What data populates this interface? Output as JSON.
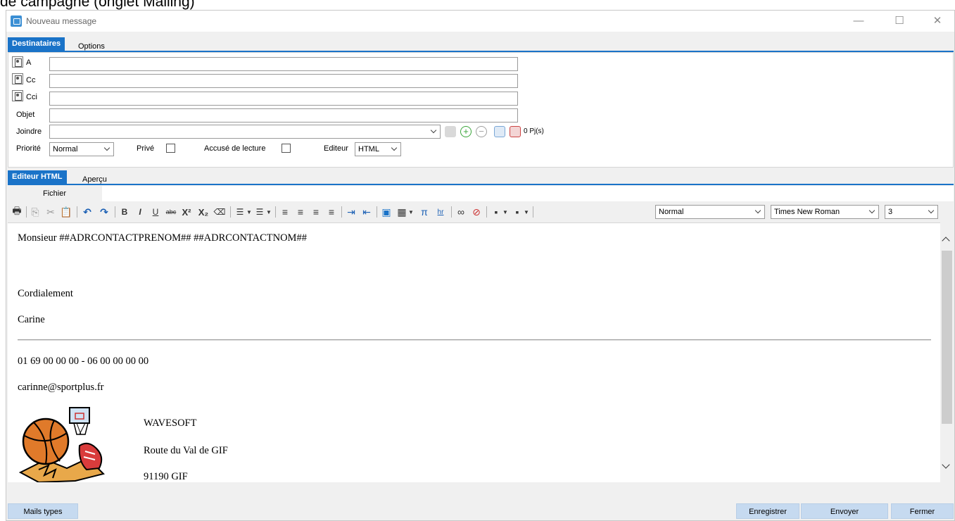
{
  "caption": "de campagne (onglet Mailing)",
  "window": {
    "title": "Nouveau message",
    "minimize": "—",
    "maximize": "☐",
    "close": "✕"
  },
  "top_tabs": [
    {
      "label": "Destinataires",
      "active": true
    },
    {
      "label": "Options",
      "active": false
    }
  ],
  "recipients": {
    "to_label": "A",
    "cc_label": "Cc",
    "bcc_label": "Cci",
    "subject_label": "Objet",
    "attach_label": "Joindre",
    "attach_count": "0 Pj(s)",
    "to_value": "",
    "cc_value": "",
    "bcc_value": "",
    "subject_value": ""
  },
  "options_row": {
    "priority_label": "Priorité",
    "priority_value": "Normal",
    "private_label": "Privé",
    "read_receipt_label": "Accusé de lecture",
    "editor_label": "Editeur",
    "editor_value": "HTML"
  },
  "editor_tabs": [
    {
      "label": "Editeur HTML",
      "active": true
    },
    {
      "label": "Aperçu",
      "active": false
    }
  ],
  "menu": {
    "file": "Fichier"
  },
  "format": {
    "style": "Normal",
    "font": "Times New Roman",
    "size": "3"
  },
  "toolbar_glyphs": {
    "print": "🖶",
    "copy": "⎘",
    "cut": "✂",
    "paste": "📋",
    "undo": "↶",
    "redo": "↷",
    "bold": "B",
    "italic": "I",
    "underline": "U",
    "strike": "abc",
    "superscript": "X²",
    "subscript": "X₂",
    "eraser": "⌫",
    "ordered_list": "☰",
    "unordered_list": "☰",
    "align_left": "≡",
    "align_center": "≡",
    "align_right": "≡",
    "justify": "≡",
    "indent": "⇥",
    "outdent": "⇤",
    "image": "▣",
    "table": "▦",
    "formula": "π",
    "hr": "hr",
    "link": "∞",
    "unlink": "⊘",
    "cell_prop": "▪",
    "row_prop": "▪"
  },
  "body": {
    "greeting": "Monsieur ##ADRCONTACTPRENOM## ##ADRCONTACTNOM##",
    "closing": "Cordialement",
    "sender": "Carine",
    "phone": "01 69 00 00 00 - 06 00 00 00 00",
    "email": "carinne@sportplus.fr",
    "company": "WAVESOFT",
    "address": "Route du Val de GIF",
    "city": "91190 GIF"
  },
  "footer": {
    "templates": "Mails types",
    "save": "Enregistrer",
    "send": "Envoyer",
    "close": "Fermer"
  },
  "colors": {
    "accent": "#1a73c8",
    "footer_button": "#c6daf0"
  }
}
